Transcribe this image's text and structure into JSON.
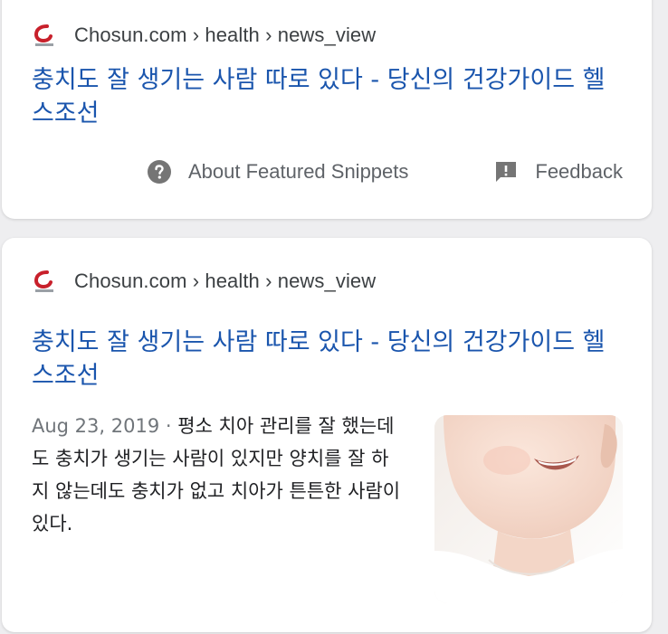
{
  "results": [
    {
      "breadcrumb": "Chosun.com › health › news_view",
      "title": "충치도 잘 생기는 사람 따로 있다 - 당신의 건강가이드 헬스조선",
      "footer": {
        "about_label": "About Featured Snippets",
        "feedback_label": "Feedback"
      }
    },
    {
      "breadcrumb": "Chosun.com › health › news_view",
      "title": "충치도 잘 생기는 사람 따로 있다 - 당신의 건강가이드 헬스조선",
      "date": "Aug 23, 2019",
      "separator": " · ",
      "snippet": "평소 치아 관리를 잘 했는데도 충치가 생기는 사람이 있지만 양치를 잘 하지 않는데도 충치가 없고 치아가 튼튼한 사람이 있다."
    }
  ],
  "colors": {
    "link": "#1a55ad",
    "brand": "#c8202b",
    "text": "#202124",
    "muted": "#70757a"
  },
  "icons": [
    "chosun-favicon",
    "help-circle-icon",
    "feedback-icon",
    "thumbnail-image"
  ]
}
